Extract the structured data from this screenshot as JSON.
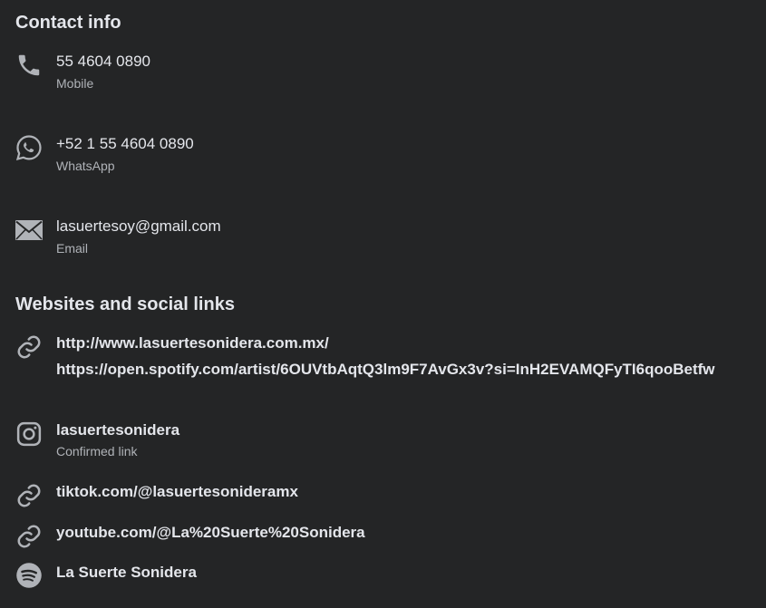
{
  "contact": {
    "title": "Contact info",
    "items": [
      {
        "icon": "phone-icon",
        "value": "55 4604 0890",
        "label": "Mobile"
      },
      {
        "icon": "whatsapp-icon",
        "value": "+52 1 55 4604 0890",
        "label": "WhatsApp"
      },
      {
        "icon": "email-icon",
        "value": "lasuertesoy@gmail.com",
        "label": "Email"
      }
    ]
  },
  "links": {
    "title": "Websites and social links",
    "website_links": [
      "http://www.lasuertesonidera.com.mx/",
      "https://open.spotify.com/artist/6OUVtbAqtQ3lm9F7AvGx3v?si=InH2EVAMQFyTI6qooBetfw"
    ],
    "instagram": {
      "value": "lasuertesonidera",
      "label": "Confirmed link"
    },
    "tiktok": "tiktok.com/@lasuertesonideramx",
    "youtube": "youtube.com/@La%20Suerte%20Sonidera",
    "spotify": "La Suerte Sonidera"
  },
  "colors": {
    "background": "#242526",
    "primary_text": "#e4e6eb",
    "secondary_text": "#b0b3b8",
    "icon": "#b0b3b8"
  }
}
